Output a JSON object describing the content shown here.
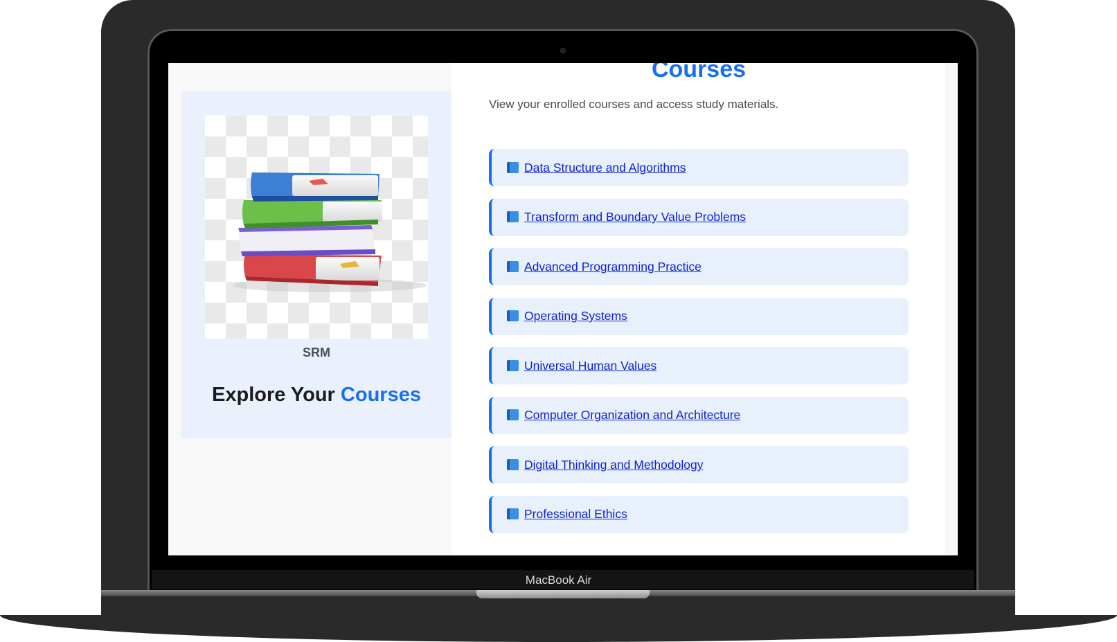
{
  "device": {
    "brand_label": "MacBook Air"
  },
  "sidebar": {
    "logo_caption": "SRM",
    "explore_prefix": "Explore Your",
    "explore_accent": "Courses"
  },
  "main": {
    "heading": "Courses",
    "subtitle": "View your enrolled courses and access study materials.",
    "courses": [
      {
        "label": "Data Structure and Algorithms"
      },
      {
        "label": "Transform and Boundary Value Problems"
      },
      {
        "label": "Advanced Programming Practice"
      },
      {
        "label": "Operating Systems"
      },
      {
        "label": "Universal Human Values"
      },
      {
        "label": "Computer Organization and Architecture"
      },
      {
        "label": "Digital Thinking and Methodology"
      },
      {
        "label": "Professional Ethics"
      }
    ]
  },
  "icons": {
    "course": "book-icon",
    "illustration": "books-stack-icon"
  },
  "colors": {
    "accent": "#1a6ef3",
    "link": "#0b1fd6",
    "card_bg": "#eaf1fd",
    "item_bg": "#e8f0fc"
  }
}
